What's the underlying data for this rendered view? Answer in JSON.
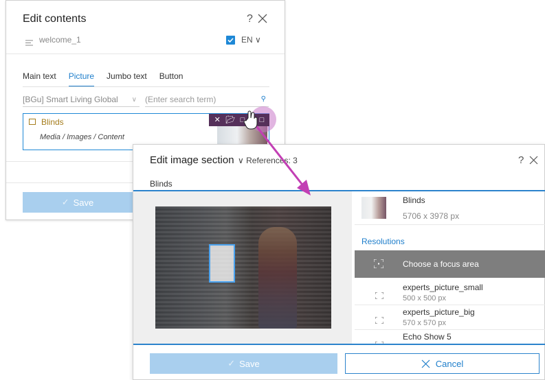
{
  "edit_contents": {
    "title": "Edit contents",
    "help_label": "?",
    "doc_name": "welcome_1",
    "language": "EN ∨",
    "tabs": [
      {
        "label": "Main text"
      },
      {
        "label": "Picture"
      },
      {
        "label": "Jumbo text"
      },
      {
        "label": "Button"
      }
    ],
    "source_select": "[BGu] Smart Living Global",
    "search_placeholder": "(Enter search term)",
    "picked_item": {
      "label": "Blinds",
      "path": "Media / Images / Content"
    },
    "save_label": "Save"
  },
  "edit_image": {
    "title": "Edit image section",
    "references": "∨ References: 3",
    "help_label": "?",
    "breadcrumb": "Blinds",
    "image": {
      "name": "Blinds",
      "size": "5706 x 3978 px"
    },
    "resolutions_label": "Resolutions",
    "focus_label": "Choose a focus area",
    "resolutions": [
      {
        "name": "experts_picture_small",
        "size": "500 x 500 px"
      },
      {
        "name": "experts_picture_big",
        "size": "570 x 570 px"
      },
      {
        "name": "Echo Show 5",
        "size": ""
      }
    ],
    "save_label": "Save",
    "cancel_label": "Cancel"
  },
  "colors": {
    "accent": "#1e7ecb",
    "save_disabled": "#a9cfee",
    "toolbar": "#55305a",
    "arrow": "#c23fb4"
  }
}
